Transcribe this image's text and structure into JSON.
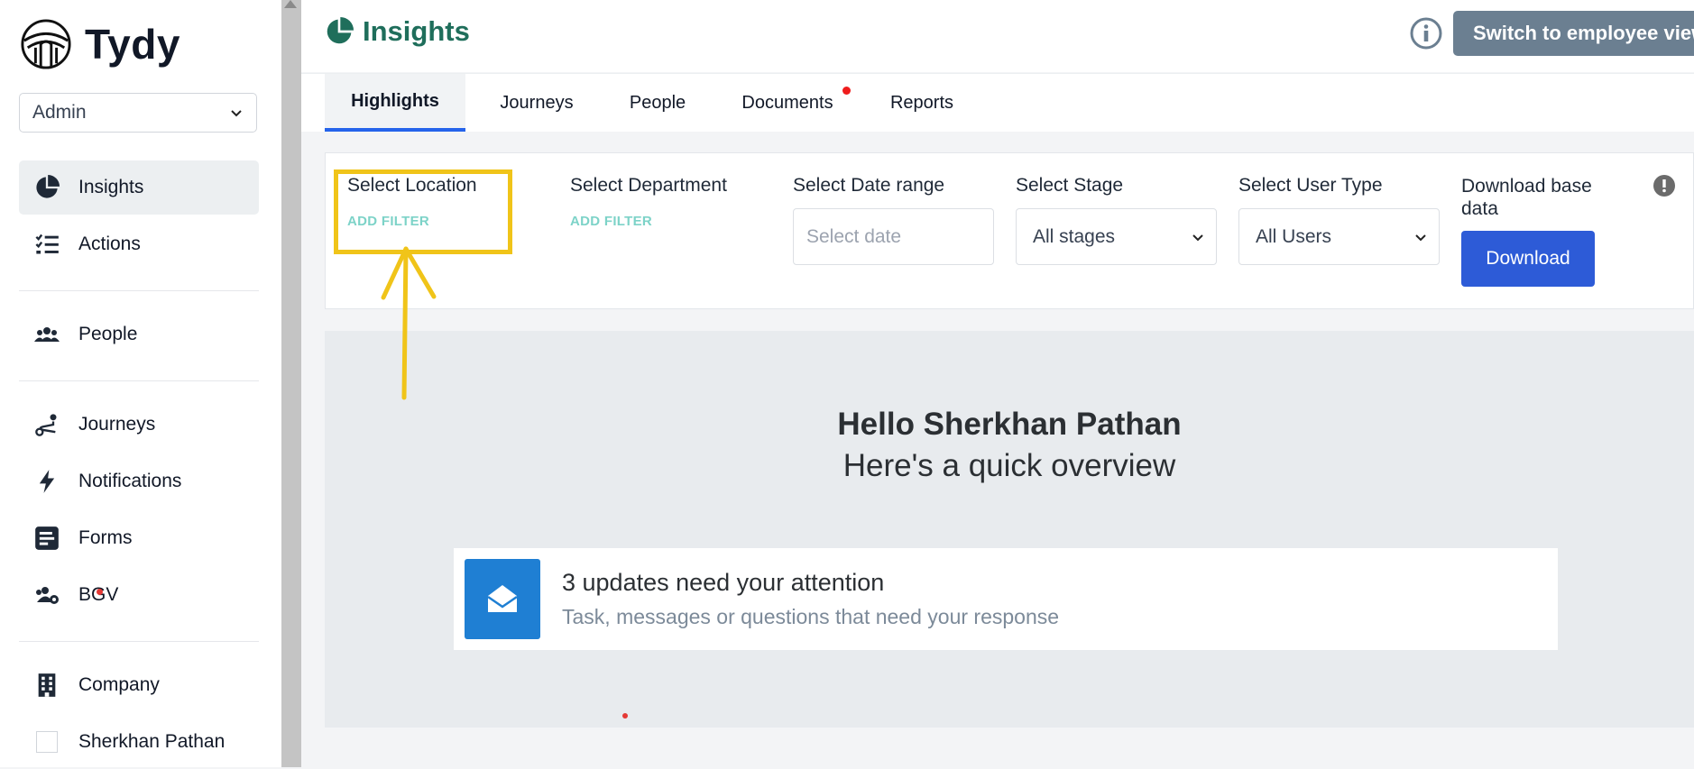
{
  "app": {
    "name": "Tydy"
  },
  "sidebar": {
    "role_select": {
      "value": "Admin"
    },
    "items": [
      {
        "label": "Insights",
        "icon": "pie-chart-icon",
        "active": true
      },
      {
        "label": "Actions",
        "icon": "checklist-icon"
      },
      {
        "label": "People",
        "icon": "users-icon"
      },
      {
        "label": "Journeys",
        "icon": "route-icon"
      },
      {
        "label": "Notifications",
        "icon": "bolt-icon"
      },
      {
        "label": "Forms",
        "icon": "form-icon"
      },
      {
        "label": "BGV",
        "icon": "users-gear-icon"
      },
      {
        "label": "Company",
        "icon": "building-icon"
      },
      {
        "label": "Sherkhan Pathan",
        "icon": "avatar"
      }
    ]
  },
  "header": {
    "title": "Insights",
    "switch_button": "Switch to employee view"
  },
  "tabs": [
    {
      "label": "Highlights",
      "active": true
    },
    {
      "label": "Journeys"
    },
    {
      "label": "People"
    },
    {
      "label": "Documents",
      "has_dot": true
    },
    {
      "label": "Reports"
    }
  ],
  "filters": {
    "location": {
      "label": "Select Location",
      "action": "ADD FILTER"
    },
    "department": {
      "label": "Select Department",
      "action": "ADD FILTER"
    },
    "date_range": {
      "label": "Select Date range",
      "placeholder": "Select date"
    },
    "stage": {
      "label": "Select Stage",
      "value": "All stages"
    },
    "user_type": {
      "label": "Select User Type",
      "value": "All Users"
    },
    "download": {
      "label_line1": "Download base",
      "label_line2": "data",
      "button": "Download"
    }
  },
  "overview": {
    "greeting": "Hello Sherkhan Pathan",
    "subtitle": "Here's a quick overview",
    "update_card": {
      "title": "3 updates need your attention",
      "subtitle": "Task, messages or questions that need your response"
    }
  },
  "colors": {
    "brand_green": "#1f6e5b",
    "primary_blue": "#2d5bd7",
    "highlight_yellow": "#f0c419",
    "add_filter_teal": "#7dd3c8"
  }
}
